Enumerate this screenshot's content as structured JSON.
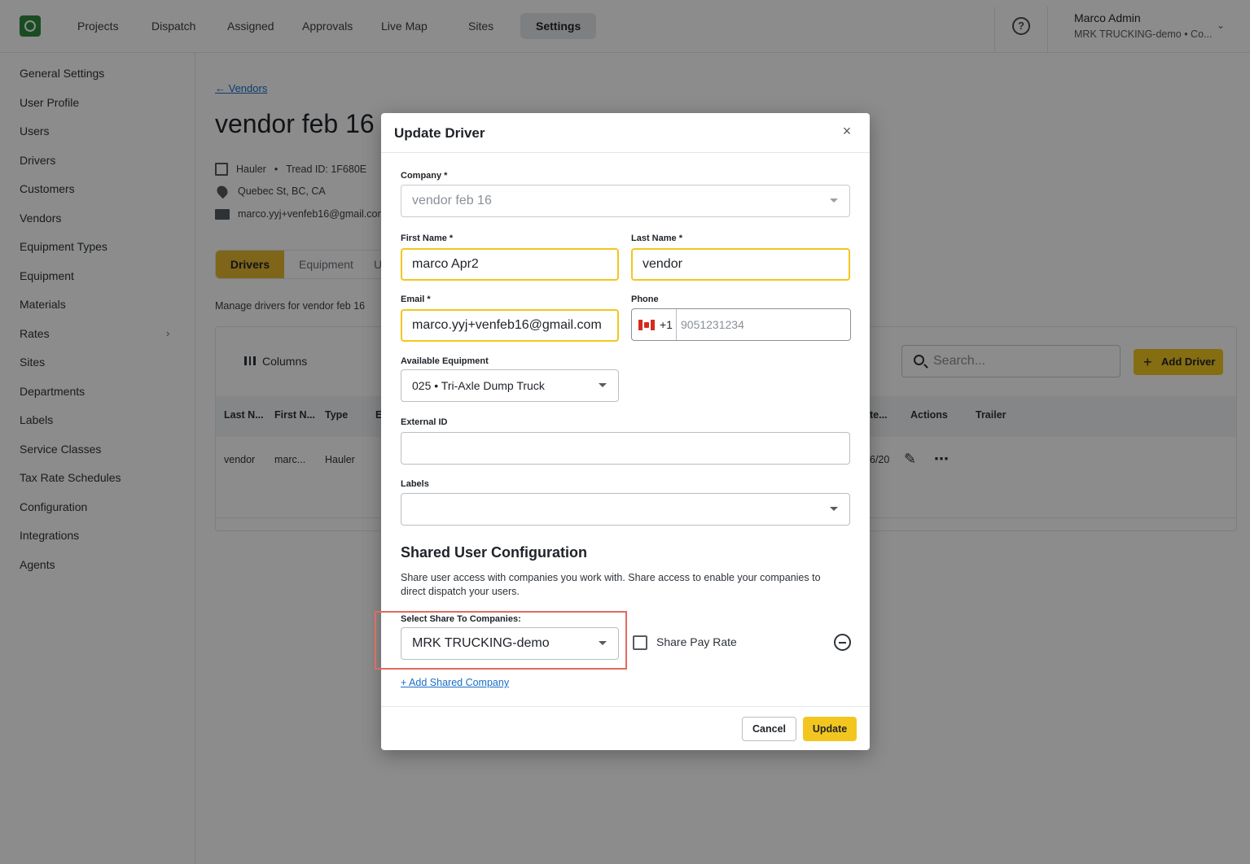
{
  "nav": {
    "items": [
      "Projects",
      "Dispatch",
      "Assigned",
      "Approvals",
      "Live Map",
      "Sites",
      "Settings"
    ],
    "active": "Settings",
    "user_name": "Marco Admin",
    "user_company": "MRK TRUCKING-demo • Co..."
  },
  "sidebar": {
    "items": [
      "General Settings",
      "User Profile",
      "Users",
      "Drivers",
      "Customers",
      "Vendors",
      "Equipment Types",
      "Equipment",
      "Materials",
      "Rates",
      "Sites",
      "Departments",
      "Labels",
      "Service Classes",
      "Tax Rate Schedules",
      "Configuration",
      "Integrations",
      "Agents"
    ]
  },
  "page": {
    "back_link": "← Vendors",
    "title": "vendor feb 16",
    "type": "Hauler",
    "tread_id": "Tread ID: 1F680E",
    "address": "Quebec St, BC, CA",
    "email": "marco.yyj+venfeb16@gmail.com",
    "tabs": [
      "Drivers",
      "Equipment",
      "U"
    ],
    "manage_text": "Manage drivers for vendor feb 16",
    "columns_label": "Columns",
    "search_placeholder": "Search...",
    "add_driver_label": "Add Driver",
    "table_headers": [
      "Last N...",
      "First N...",
      "Type",
      "E",
      "te...",
      "Actions",
      "Trailer"
    ],
    "row": {
      "last": "vendor",
      "first": "marc...",
      "type": "Hauler",
      "date": "6/20"
    }
  },
  "modal": {
    "title": "Update Driver",
    "company_label": "Company *",
    "company_value": "vendor feb 16",
    "first_name_label": "First Name *",
    "first_name_value": "marco Apr2",
    "last_name_label": "Last Name *",
    "last_name_value": "vendor",
    "email_label": "Email *",
    "email_value": "marco.yyj+venfeb16@gmail.com",
    "phone_label": "Phone",
    "phone_code": "+1",
    "phone_placeholder": "9051231234",
    "equipment_label": "Available Equipment",
    "equipment_value": "025 • Tri-Axle Dump Truck",
    "external_id_label": "External ID",
    "external_id_value": "",
    "labels_label": "Labels",
    "shared_title": "Shared User Configuration",
    "shared_desc": "Share user access with companies you work with. Share access to enable your companies to direct dispatch your users.",
    "share_to_label": "Select Share To Companies:",
    "share_to_value": "MRK TRUCKING-demo",
    "share_pay_rate_label": "Share Pay Rate",
    "share_pay_rate_checked": false,
    "add_shared_label": "+ Add Shared Company",
    "cancel_label": "Cancel",
    "update_label": "Update"
  },
  "colors": {
    "accent": "#f2c61f",
    "tab_active": "#e8b830",
    "link": "#1a6ec7",
    "highlight": "#e06a60"
  }
}
